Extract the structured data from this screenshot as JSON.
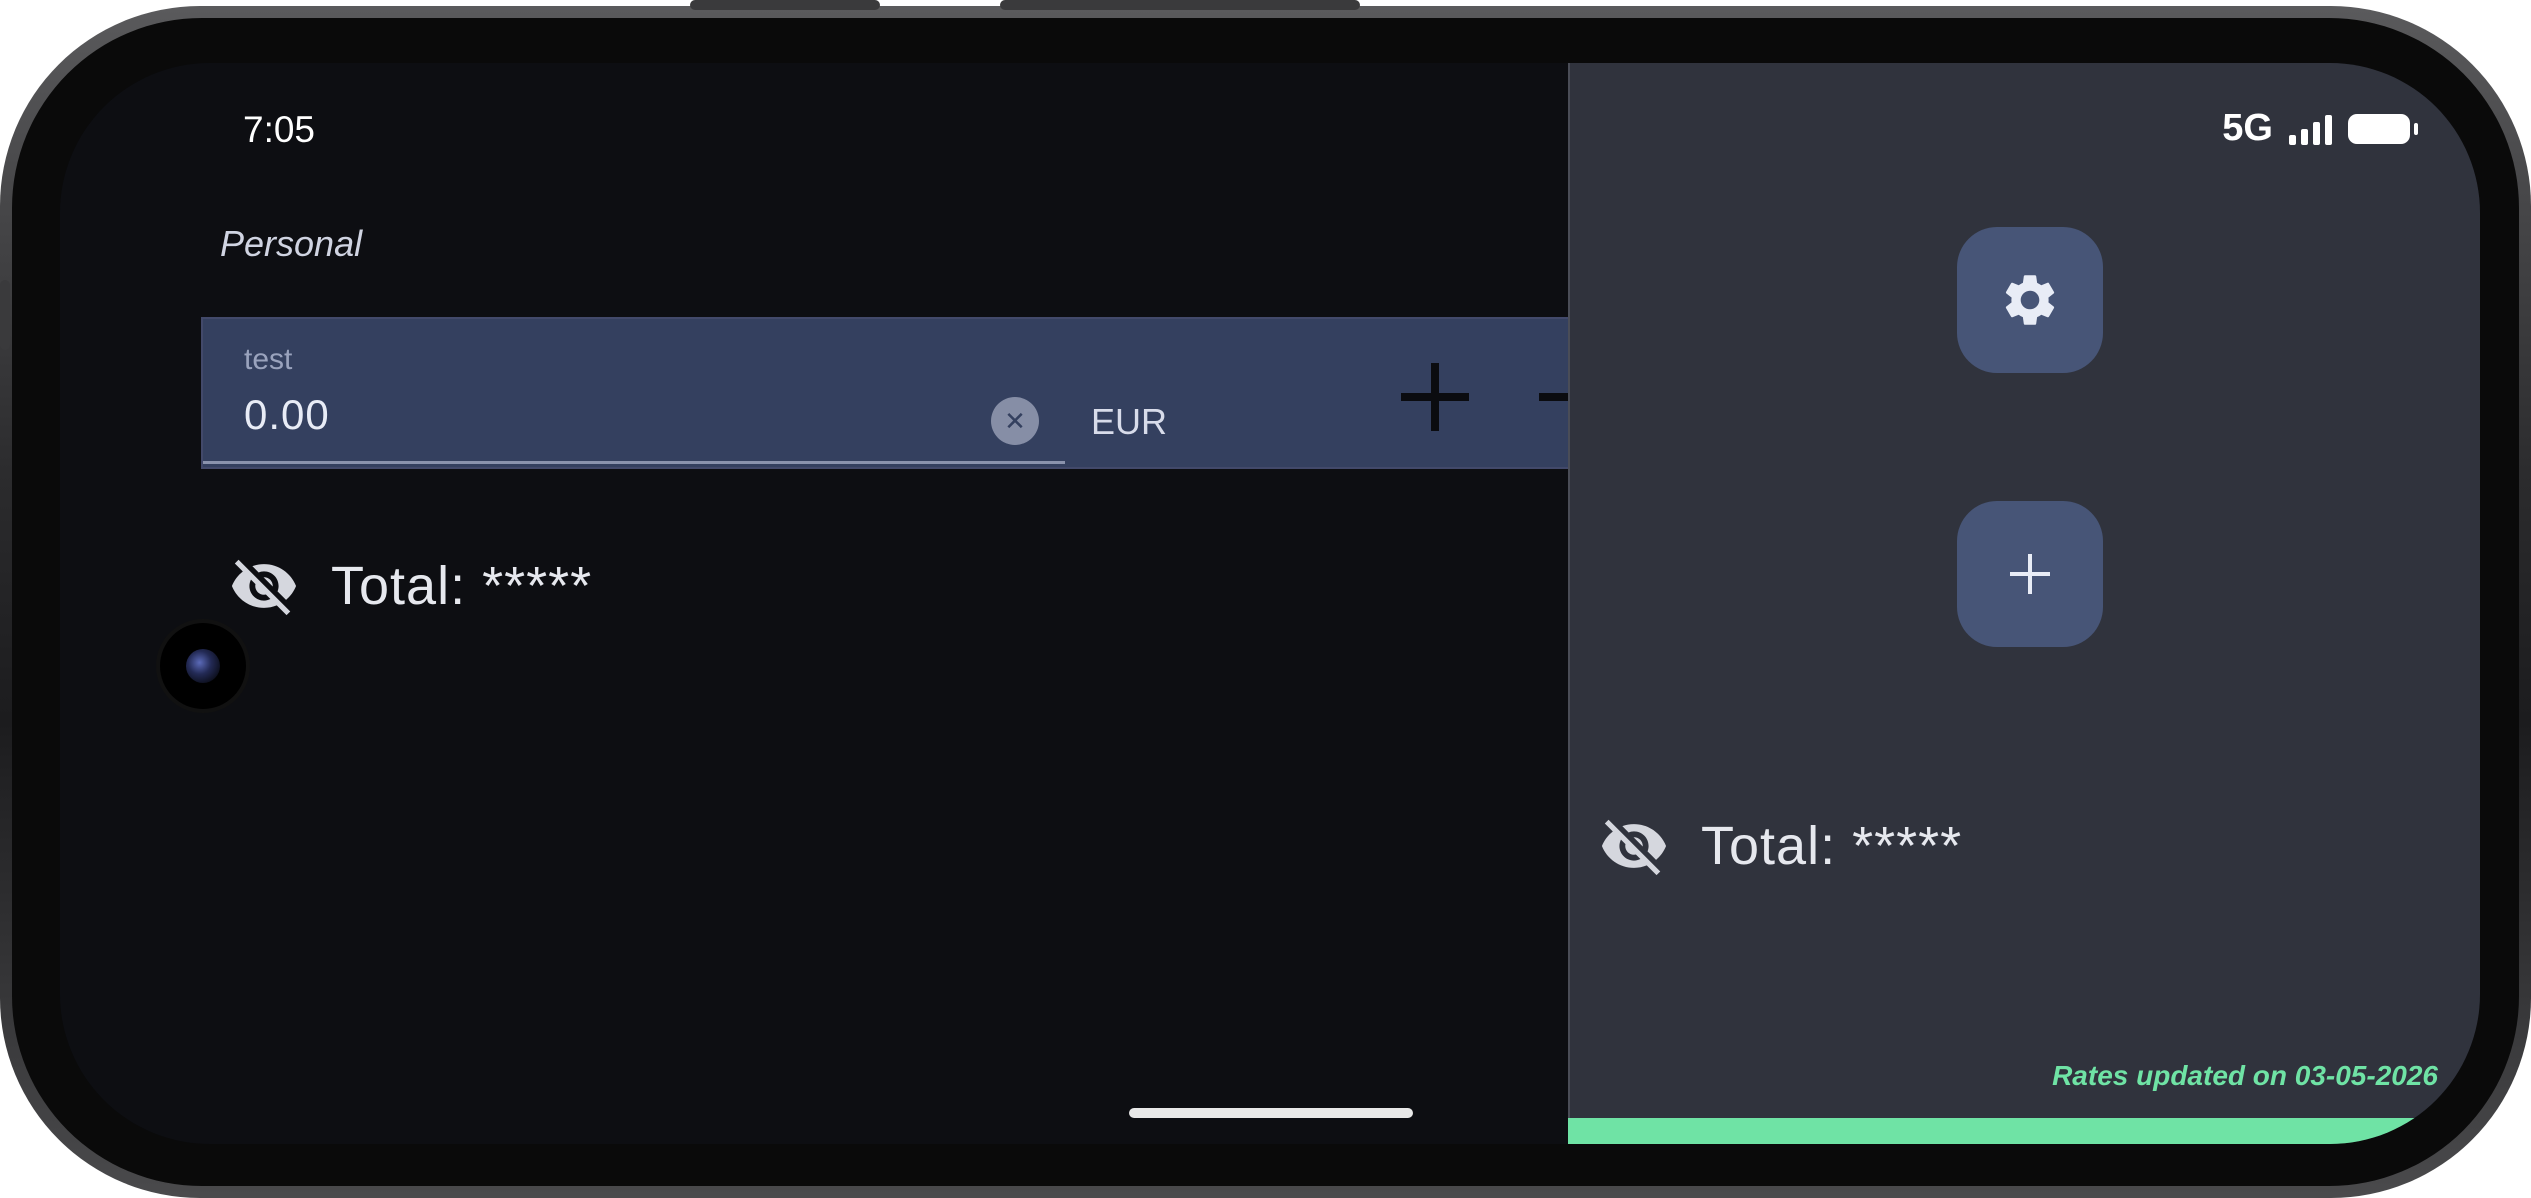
{
  "status_bar": {
    "time": "7:05",
    "network": "5G"
  },
  "profile": {
    "label": "Personal"
  },
  "entry": {
    "label": "test",
    "value": "0.00",
    "currency": "EUR"
  },
  "total_left": {
    "text": "Total: *****"
  },
  "total_right": {
    "text": "Total: *****"
  },
  "footer": {
    "rates_text": "Rates updated on 03-05-2026",
    "progress": 1.0
  },
  "icons": {
    "visibility": "eye-off-icon",
    "settings": "gear-icon",
    "add": "plus-icon",
    "increment": "plus-icon",
    "decrement": "minus-icon",
    "clear": "close-icon"
  },
  "colors": {
    "background": "#0d0e12",
    "side_panel": "#30333d",
    "card": "#34405f",
    "fab": "#475577",
    "accent": "#6fe3a5"
  }
}
